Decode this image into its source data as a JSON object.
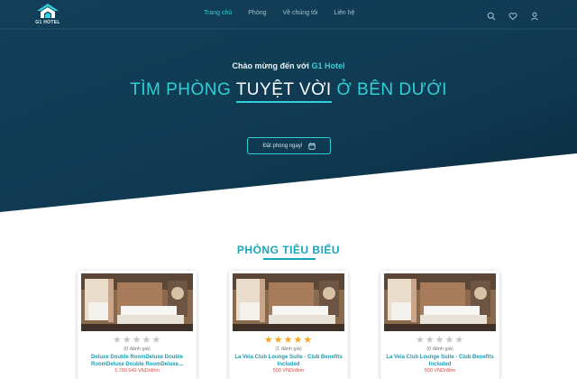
{
  "header": {
    "logo_text": "G1 HOTEL",
    "nav": [
      "Trang chủ",
      "Phòng",
      "Về chúng tôi",
      "Liên hệ"
    ],
    "active_nav": 0,
    "icons": [
      "search-icon",
      "heart-icon",
      "user-icon"
    ]
  },
  "hero": {
    "welcome_prefix": "Chào mừng đến với",
    "welcome_brand": "G1 Hotel",
    "headline_before": "TÌM PHÒNG",
    "headline_highlight": "TUYỆT VỜI",
    "headline_after": "Ở BÊN DƯỚI",
    "cta_label": "Đặt phòng ngay!",
    "cta_icon": "calendar-icon"
  },
  "featured": {
    "title": "PHÒNG TIÊU BIỂU",
    "rooms": [
      {
        "rating": 0,
        "reviews": "(0 đánh giá)",
        "name": "Deluxe Double RoomDeluxe Double RoomDeluxe Double RoomDeluxe...",
        "price": "1.780.549 VND/đêm"
      },
      {
        "rating": 5,
        "reviews": "(1 đánh giá)",
        "name": "La Vela Club Lounge Suite - Club Benefits Included",
        "price": "500 VND/đêm"
      },
      {
        "rating": 0,
        "reviews": "(0 đánh giá)",
        "name": "La Vela Club Lounge Suite - Club Benefits Included",
        "price": "500 VND/đêm"
      }
    ]
  },
  "colors": {
    "hero_bg": "#0f3a52",
    "accent": "#2fd1d6",
    "section_title": "#17a6b8",
    "price": "#e04a3f",
    "star_on": "#f5a623",
    "star_off": "#c6c6c6"
  }
}
